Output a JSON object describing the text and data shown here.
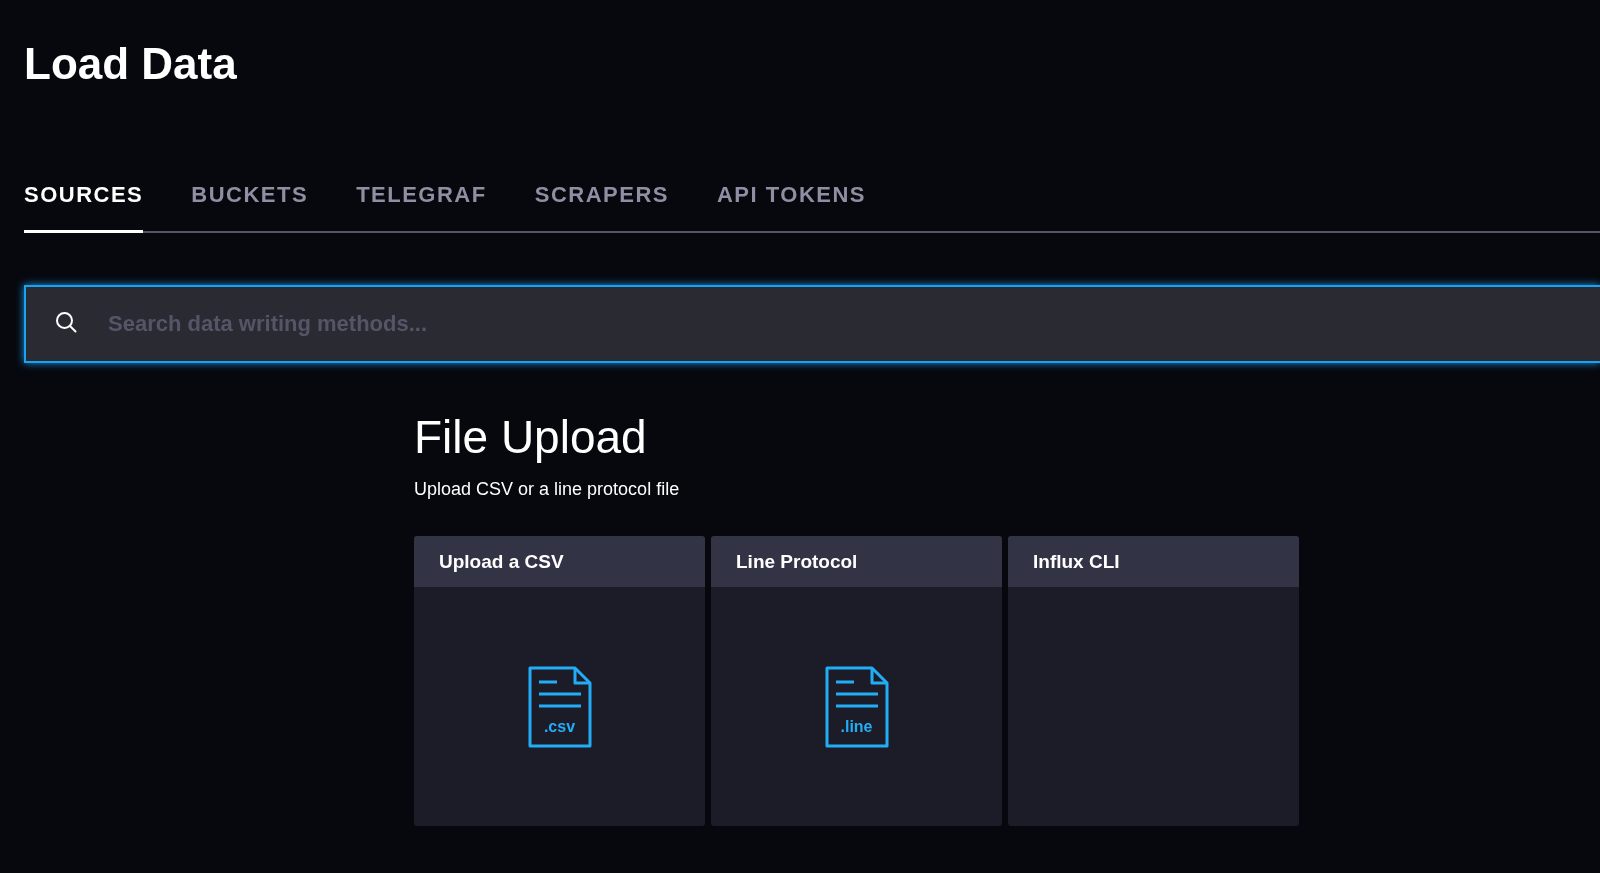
{
  "page": {
    "title": "Load Data"
  },
  "tabs": [
    {
      "label": "SOURCES",
      "selected": true
    },
    {
      "label": "BUCKETS",
      "selected": false
    },
    {
      "label": "TELEGRAF",
      "selected": false
    },
    {
      "label": "SCRAPERS",
      "selected": false
    },
    {
      "label": "API TOKENS",
      "selected": false
    }
  ],
  "search": {
    "placeholder": "Search data writing methods..."
  },
  "section": {
    "title": "File Upload",
    "subtitle": "Upload CSV or a line protocol file",
    "cards": [
      {
        "title": "Upload a CSV",
        "extension": ".csv"
      },
      {
        "title": "Line Protocol",
        "extension": ".line"
      },
      {
        "title": "Influx CLI"
      }
    ]
  }
}
